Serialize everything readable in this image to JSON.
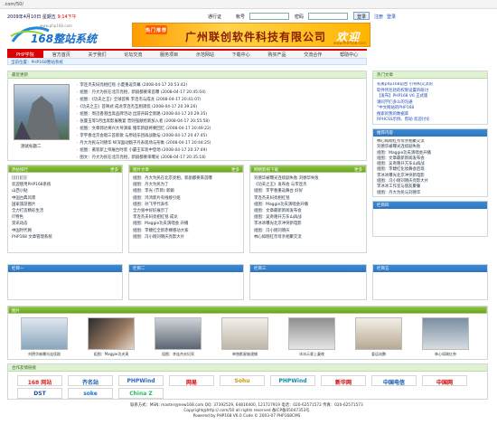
{
  "address_bar": {
    "url": ".com/50/"
  },
  "topbar": {
    "date": "2009年4月10日 星期五",
    "time": "9:14下午",
    "username_label": "通行证",
    "account_label": "帐号",
    "password_label": "密码",
    "login_button": "登录",
    "register_link": "注册",
    "logout_link": "登录"
  },
  "logo": {
    "site_url": "www.php168.com",
    "title": "168整站系统"
  },
  "banner": {
    "tag": "热门推荐",
    "text": "广州联创软件科技有限公司",
    "sig": "欢迎",
    "url": "www.PHP168.com"
  },
  "nav": {
    "items": [
      "PHP学院",
      "官方首页",
      "关于我们",
      "论坛交流",
      "服务项目",
      "示范网站",
      "下载中心",
      "购买产品",
      "交流合作",
      "帮助中心"
    ],
    "active": 0
  },
  "breadcrumb": {
    "text": "当前位置：PHP168整站系统"
  },
  "top_news": {
    "title": "最近更新",
    "image_caption": "测试标题二",
    "items": [
      {
        "title": "李连杰夫妇亮相红毯 小夏重返荧幕",
        "date": "(2008-04-17 20:53:42)"
      },
      {
        "title": "组图：丹大为民在北京亮相，新剧都要来首曝",
        "date": "(2008-04-17 20:45:04)"
      },
      {
        "title": "组图：《功夫之王》全球首映 李连杰与成龙",
        "date": "(2008-04-17 20:41:07)"
      },
      {
        "title": "《功夫之王》首映式 成龙李连杰互相调侃",
        "date": "(2008-04-17 20:39:26)"
      },
      {
        "title": "组图：周迅香港出席品牌活动 出游开辟全新路",
        "date": "(2008-04-17 20:29:35)"
      },
      {
        "title": "张曼玉等5月出席影展晚宴 曾则强献给新加入者",
        "date": "(2008-04-17 20:55:58)"
      },
      {
        "title": "组图：文章郭达将兴大导演家 猪年新剧将要回忆",
        "date": "(2008-04-17 20:49:22)"
      },
      {
        "title": "李宇春北京会唱三首新歌 与原班乐团再战歌坛",
        "date": "(2008-04-17 20:47:45)"
      },
      {
        "title": "丹大为民与刘德华 纵深面动甄子丹表现场与形象",
        "date": "(2008-04-17 20:44:25)"
      },
      {
        "title": "组图：著装新上师展台时装 小霸王军装中登场",
        "date": "(2008-04-17 20:37:49)"
      },
      {
        "title": "图文：丹大为民在北京亮相，新剧都要来曝光",
        "date": "(2008-04-17 20:35:18)"
      }
    ]
  },
  "hot": {
    "title": "热门文章",
    "items": [
      {
        "text": "有关php168前台 引导和交流的",
        "cls": "blue"
      },
      {
        "text": "软件所包括的权限设置的研讨",
        "cls": "blue"
      },
      {
        "text": "【发布】PHP168 V6 正式版",
        "cls": "blue"
      },
      {
        "text": "请同学们多么的沟通",
        "cls": "blue"
      },
      {
        "text": "“中文网站的PHP168",
        "cls": "blue"
      },
      {
        "text": "搜索的我的数据库",
        "cls": "blue"
      },
      {
        "text": "RPHCSS示例、帮助 欢迎讨论",
        "cls": "blue"
      }
    ]
  },
  "recommend": {
    "title": "推荐内容",
    "items": [
      "林心如刚红奈母亲相聚交流",
      "刘德华被曝光连续剧失败",
      "组图：Maggie功夫演唱会开播",
      "组图：文章最新新闻发布会",
      "组图：吴奇隆开方东山再战",
      "组图：李婕红化妆舞会后现",
      "李冰冰曝光北京冲突新电影",
      "组图：冯小刚刘晓庆亮影大片",
      "李冰冰工作室与朋友聚餐",
      "组图：丹大为民与刘德华"
    ]
  },
  "mid_panels": [
    {
      "title": "热帖排行",
      "items": [
        "[[[[[[[[[[",
        "欢迎使用PHP168系统",
        "山西小贴",
        "中国古典风景",
        "国家旅游图片",
        "全力打造精彩生活",
        "IT特色",
        "资讯动态",
        "中国时代网",
        "PHP168 文章管理系统"
      ]
    },
    {
      "title": "图片文章",
      "items": [
        "组图：丹大为民在北京亮相，新剧都要来首曝",
        "组图：丹大为民为了",
        "组图：李光 (节目) 新颖",
        "组图：鸿鸿新片有线接引组",
        "组图：孙飞宇代表作",
        "全力张中好好展示了",
        "李连杰夫妇亮相红毯 成龙",
        "组图：Maggie功夫演唱会 开播",
        "组图：李婕红全新赤裸感动大家",
        "组图：冯小刚刘晓庆亮影大片"
      ]
    },
    {
      "title": "网络影视下载",
      "items": [
        "刘德华被曝光连续剧失败 刘德华失败",
        "《功夫之王》发布会 与李连杰",
        "组图：李宇春重返舞台 好好",
        "李连杰夫妇亮相红毯",
        "组图：Maggie功夫演唱会开播",
        "组图：文章最新新闻发布会",
        "组图：吴奇隆开方东山再战",
        "李冰冰曝光北京冲突新电影",
        "组图：冯小刚刘晓庆",
        "林心如刚红奈母亲相聚交流"
      ]
    }
  ],
  "empty_panels": [
    {
      "title": "栏目一"
    },
    {
      "title": "栏目二"
    },
    {
      "title": "栏目三"
    },
    {
      "title": "栏目四"
    },
    {
      "title": "栏目五"
    }
  ],
  "gallery": {
    "title": "图片",
    "items": [
      "刘德华被曝光连续剧",
      "组图：Maggie功夫演",
      "组图：李连杰夫妇亮",
      "单独影星被逮捕",
      "冰冰示意上妻夜",
      "爱运站鹏",
      "林心如刚红奈"
    ]
  },
  "friend_links": {
    "title": "合作友情链接",
    "logos": [
      {
        "text": "168 网站",
        "color": "#d22"
      },
      {
        "text": "齐名站",
        "color": "#1a5bb5"
      },
      {
        "text": "PHPWind",
        "color": "#2a63c8"
      },
      {
        "text": "网易",
        "color": "#d00"
      },
      {
        "text": "Sohu",
        "color": "#c90"
      },
      {
        "text": "PHPWind",
        "color": "#18a"
      },
      {
        "text": "新华网",
        "color": "#c00"
      },
      {
        "text": "中国电信",
        "color": "#0a55a4"
      },
      {
        "text": "中国网",
        "color": "#c00"
      },
      {
        "text": "DST",
        "color": "#264d9b"
      },
      {
        "text": "soke",
        "color": "#1475d3"
      },
      {
        "text": "China Z",
        "color": "#2b6"
      }
    ]
  },
  "footer": {
    "line1": "联系方式：MSN: master@new168.com  QQ: 37392529, 64816400, 121727919  电话：020-62571572  传真：020-62571573",
    "line2": "Copyright@http://.com/50 all rights reserved  备ICP备05047353号",
    "line3": "Powered by PHP168 V6.0 Code © 2003-07 PHP168CMS"
  }
}
